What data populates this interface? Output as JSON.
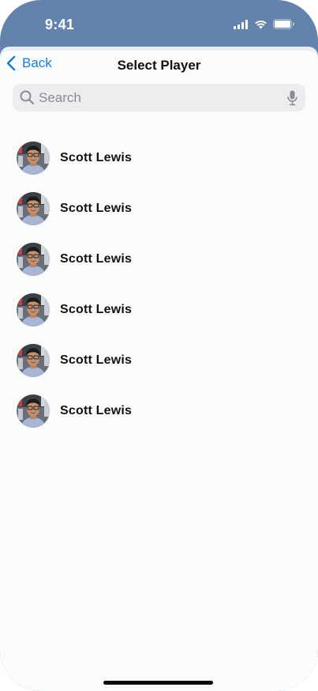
{
  "status_bar": {
    "time": "9:41",
    "signal_icon": "cellular-signal-icon",
    "wifi_icon": "wifi-icon",
    "battery_icon": "battery-icon"
  },
  "nav": {
    "back_label": "Back",
    "title": "Select Player"
  },
  "search": {
    "placeholder": "Search",
    "value": ""
  },
  "players": [
    {
      "name": "Scott Lewis"
    },
    {
      "name": "Scott Lewis"
    },
    {
      "name": "Scott Lewis"
    },
    {
      "name": "Scott Lewis"
    },
    {
      "name": "Scott Lewis"
    },
    {
      "name": "Scott Lewis"
    }
  ],
  "colors": {
    "header_background": "#6383ac",
    "accent": "#1a7fd4",
    "sheet_background": "#fafcfc",
    "search_background": "#ebedef"
  }
}
